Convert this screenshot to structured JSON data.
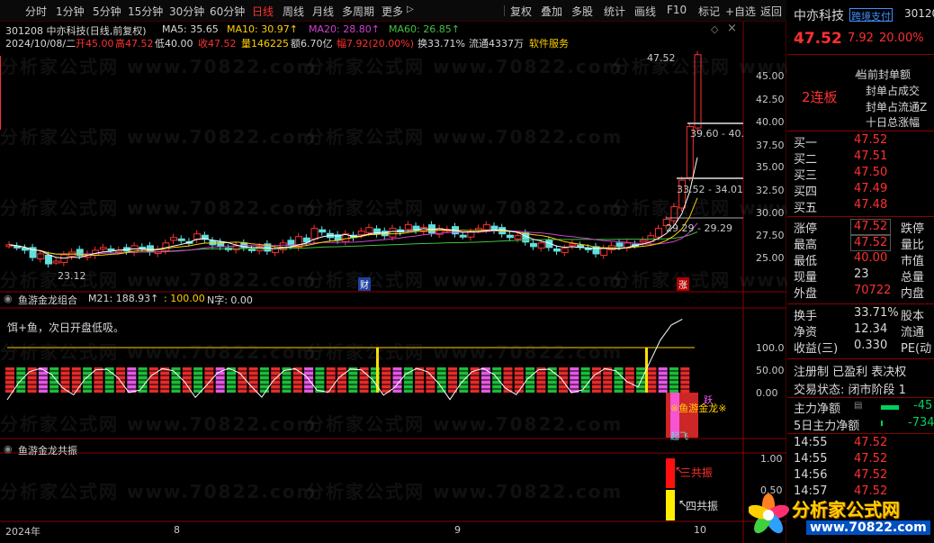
{
  "toolbar": {
    "periods": [
      "分时",
      "1分钟",
      "5分钟",
      "15分钟",
      "30分钟",
      "60分钟",
      "日线",
      "周线",
      "月线",
      "多周期",
      "更多"
    ],
    "active_period": "日线",
    "more_arrow": "▷",
    "actions": [
      "复权",
      "叠加",
      "多股",
      "统计",
      "画线",
      "F10",
      "标记",
      "+自选",
      "返回"
    ]
  },
  "header": {
    "code_title": "301208 中亦科技(日线,前复权)",
    "ma5": "MA5: 35.65",
    "ma10": "MA10: 30.97↑",
    "ma20": "MA20: 28.80↑",
    "ma60": "MA60: 26.85↑",
    "date": "2024/10/08/二",
    "open": "开45.00",
    "high": "高47.52",
    "low": "低40.00",
    "close": "收47.52",
    "volume": "量146225",
    "amount": "额6.70亿",
    "amplitude": "幅7.92(20.00%)",
    "turnover": "换33.71%",
    "float": "流通4337万",
    "sector": "软件服务"
  },
  "main_chart": {
    "y_ticks": [
      "45.00",
      "42.50",
      "40.00",
      "37.50",
      "35.00",
      "32.50",
      "30.00",
      "27.50",
      "25.00"
    ],
    "price_labels": [
      "47.52",
      "39.60 - 40.",
      "33.52 - 34.01",
      "29.29 - 29.29",
      "23.12"
    ],
    "event_labels": [
      "财",
      "涨"
    ]
  },
  "panel2": {
    "title": "鱼游金龙组合",
    "m21": "M21: 188.93↑",
    "val100": ": 100.00",
    "nzi": "N字: 0.00",
    "note": "饵+鱼，次日开盘低吸。",
    "y_ticks": [
      "100.0",
      "50.00",
      "0.00"
    ],
    "signal_texts": [
      "※鱼游金龙※",
      "蛟龙",
      "跃",
      "起飞"
    ]
  },
  "panel3": {
    "title": "鱼游金龙共振",
    "y_ticks": [
      "1.00",
      "0.50"
    ],
    "labels": [
      "三共振",
      "四共振"
    ]
  },
  "date_axis": [
    "2024年",
    "8",
    "9",
    "10"
  ],
  "watermark": "分析家公式网 www.70822.com",
  "sidebar": {
    "name": "中亦科技",
    "tag": "跨境支付",
    "code": "30120",
    "price": "47.52",
    "change": "7.92",
    "pct": "20.00%",
    "limit_tag": "2连板",
    "metrics": [
      "当前封单额",
      "封单占成交",
      "封单占流通Z",
      "十日总涨幅"
    ],
    "bids": [
      {
        "label": "买一",
        "price": "47.52"
      },
      {
        "label": "买二",
        "price": "47.51"
      },
      {
        "label": "买三",
        "price": "47.50"
      },
      {
        "label": "买四",
        "price": "47.49"
      },
      {
        "label": "买五",
        "price": "47.48"
      }
    ],
    "quote": [
      {
        "l": "涨停",
        "v": "47.52",
        "r": "跌停"
      },
      {
        "l": "最高",
        "v": "47.52",
        "r": "量比"
      },
      {
        "l": "最低",
        "v": "40.00",
        "r": "市值"
      },
      {
        "l": "现量",
        "v": "23",
        "r": "总量"
      },
      {
        "l": "外盘",
        "v": "70722",
        "r": "内盘"
      }
    ],
    "fin": [
      {
        "l": "换手",
        "v": "33.71%",
        "r": "股本"
      },
      {
        "l": "净资",
        "v": "12.34",
        "r": "流通"
      },
      {
        "l": "收益(三)",
        "v": "0.330",
        "r": "PE(动"
      }
    ],
    "status1": "注册制 已盈利 表决权",
    "status2": "交易状态: 闭市阶段 1",
    "flow": [
      {
        "l": "主力净额",
        "v": "-45"
      },
      {
        "l": "5日主力净额",
        "v": "-734"
      }
    ],
    "ticks": [
      {
        "t": "14:55",
        "p": "47.52"
      },
      {
        "t": "14:55",
        "p": "47.52"
      },
      {
        "t": "14:56",
        "p": "47.52"
      },
      {
        "t": "14:57",
        "p": "47.52"
      }
    ]
  },
  "logo": {
    "text": "分析家公式网",
    "url": "www.70822.com"
  },
  "colors": {
    "up": "#ff3030",
    "down": "#60e0e0",
    "ma5": "#ffffff",
    "ma10": "#ffd000",
    "ma20": "#d040d0",
    "ma60": "#40c040"
  }
}
